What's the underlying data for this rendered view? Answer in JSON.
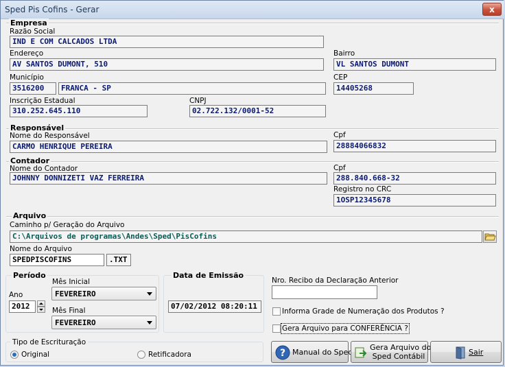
{
  "window": {
    "title": "Sped Pis Cofins - Gerar",
    "close_glyph": "x"
  },
  "empresa": {
    "section": "Empresa",
    "razao_label": "Razão Social",
    "razao_value": "IND E COM CALCADOS LTDA",
    "endereco_label": "Endereço",
    "endereco_value": "AV SANTOS DUMONT, 510",
    "bairro_label": "Bairro",
    "bairro_value": "VL SANTOS DUMONT",
    "municipio_label": "Município",
    "municipio_code": "3516200",
    "municipio_name": "FRANCA - SP",
    "cep_label": "CEP",
    "cep_value": "14405268",
    "ie_label": "Inscrição Estadual",
    "ie_value": "310.252.645.110",
    "cnpj_label": "CNPJ",
    "cnpj_value": "02.722.132/0001-52"
  },
  "responsavel": {
    "section": "Responsável",
    "nome_label": "Nome do Responsável",
    "nome_value": "CARMO HENRIQUE PEREIRA",
    "cpf_label": "Cpf",
    "cpf_value": "28884066832"
  },
  "contador": {
    "section": "Contador",
    "nome_label": "Nome do Contador",
    "nome_value": "JOHNNY DONNIZETI VAZ FERREIRA",
    "cpf_label": "Cpf",
    "cpf_value": "288.840.668-32",
    "crc_label": "Registro no CRC",
    "crc_value": "1OSP12345678"
  },
  "arquivo": {
    "section": "Arquivo",
    "caminho_label": "Caminho p/ Geração do Arquivo",
    "caminho_value": "C:\\Arquivos de programas\\Andes\\Sped\\PisCofins",
    "nome_label": "Nome do Arquivo",
    "nome_value": "SPEDPISCOFINS",
    "ext_value": ".TXT"
  },
  "periodo": {
    "section": "Período",
    "ano_label": "Ano",
    "ano_value": "2012",
    "mes_inicial_label": "Mês Inicial",
    "mes_inicial_value": "FEVEREIRO",
    "mes_final_label": "Mês Final",
    "mes_final_value": "FEVEREIRO"
  },
  "emissao": {
    "section": "Data de Emissão",
    "value": "07/02/2012 08:20:11"
  },
  "recibo": {
    "label": "Nro. Recibo da Declaração Anterior",
    "value": ""
  },
  "options": {
    "grade_label": "Informa Grade de Numeração dos Produtos ?",
    "conferencia_label": "Gera Arquivo para CONFERÊNCIA ?"
  },
  "escrituracao": {
    "section": "Tipo de Escrituração",
    "original_label": "Original",
    "retificadora_label": "Retificadora"
  },
  "buttons": {
    "manual_label": "Manual do Sped",
    "gera_line1": "Gera Arquivo do",
    "gera_line2": "Sped Contábil",
    "sair_label": "Sair"
  },
  "colors": {
    "field_text": "#0b1a70",
    "path_text": "#0a5a55",
    "accent": "#2d6cc0"
  }
}
